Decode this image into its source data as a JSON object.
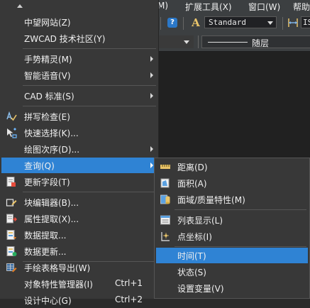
{
  "menubar": {
    "item_m": "M)",
    "item_ext": "扩展工具(X)",
    "item_window": "窗口(W)",
    "item_help": "帮助"
  },
  "toolbar": {
    "help_glyph": "?",
    "text_style_glyph": "A",
    "text_style_value": "Standard",
    "dim_style_value": "IS"
  },
  "layer_toolbar": {
    "linetype_value": "随层"
  },
  "context_menu": {
    "items": [
      {
        "label": "中望网站(Z)"
      },
      {
        "label": "ZWCAD 技术社区(Y)"
      },
      {
        "label": "手势精灵(M)",
        "submenu": true
      },
      {
        "label": "智能语音(V)",
        "submenu": true
      },
      {
        "label": "CAD 标准(S)",
        "submenu": true
      },
      {
        "label": "拼写检查(E)",
        "icon": "spell-check-icon"
      },
      {
        "label": "快速选择(K)...",
        "icon": "quick-select-icon"
      },
      {
        "label": "绘图次序(D)...",
        "submenu": true
      },
      {
        "label": "查询(Q)",
        "submenu": true,
        "selected": true
      },
      {
        "label": "更新字段(T)",
        "icon": "update-field-icon"
      },
      {
        "label": "块编辑器(B)...",
        "icon": "block-editor-icon"
      },
      {
        "label": "属性提取(X)...",
        "icon": "attribute-extract-icon"
      },
      {
        "label": "数据提取...",
        "icon": "data-extract-icon"
      },
      {
        "label": "数据更新...",
        "icon": "data-update-icon"
      },
      {
        "label": "手绘表格导出(W)",
        "icon": "table-export-icon"
      },
      {
        "label": "对象特性管理器(I)",
        "shortcut": "Ctrl+1"
      },
      {
        "label": "设计中心(G)",
        "shortcut": "Ctrl+2"
      }
    ]
  },
  "query_submenu": {
    "items": [
      {
        "label": "距离(D)",
        "icon": "distance-icon"
      },
      {
        "label": "面积(A)",
        "icon": "area-icon"
      },
      {
        "label": "面域/质量特性(M)",
        "icon": "mass-properties-icon"
      },
      {
        "label": "列表显示(L)",
        "icon": "list-icon"
      },
      {
        "label": "点坐标(I)",
        "icon": "point-coordinate-icon"
      },
      {
        "label": "时间(T)",
        "selected": true
      },
      {
        "label": "状态(S)"
      },
      {
        "label": "设置变量(V)"
      }
    ]
  },
  "colors": {
    "highlight": "#2f83d4",
    "menu_bg": "#383838",
    "canvas_bg": "#212121"
  }
}
